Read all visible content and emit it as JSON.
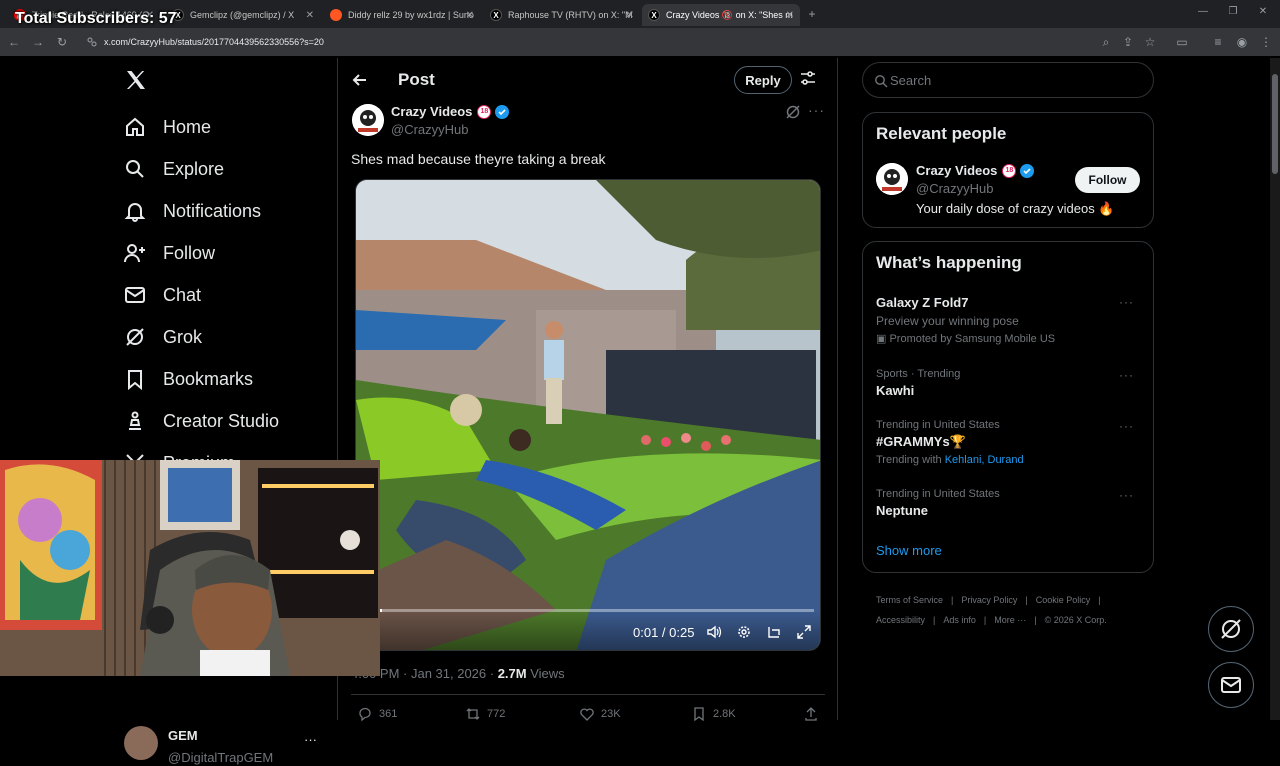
{
  "overlay": {
    "subscribers": "Total Subscribers: 57"
  },
  "browser": {
    "tabs": [
      {
        "title": "Trippie Redd - Rolex 1469 (O",
        "icon_color": "#ff0000"
      },
      {
        "title": "Gemclipz (@gemclipz) / X",
        "icon_color": "#000000"
      },
      {
        "title": "Diddy rellz 29 by wx1rdz | Suno",
        "icon_color": "#ff5722"
      },
      {
        "title": "Raphouse TV (RHTV) on X: \"M",
        "icon_color": "#000000"
      },
      {
        "title": "Crazy Videos 🔞 on X: \"Shes m",
        "icon_color": "#000000"
      }
    ],
    "url": "x.com/CrazyyHub/status/2017704439562330556?s=20"
  },
  "nav": {
    "items": [
      {
        "label": "Home",
        "icon": "home-icon"
      },
      {
        "label": "Explore",
        "icon": "search-icon"
      },
      {
        "label": "Notifications",
        "icon": "bell-icon"
      },
      {
        "label": "Follow",
        "icon": "person-plus-icon"
      },
      {
        "label": "Chat",
        "icon": "envelope-icon"
      },
      {
        "label": "Grok",
        "icon": "grok-icon"
      },
      {
        "label": "Bookmarks",
        "icon": "bookmark-icon"
      },
      {
        "label": "Creator Studio",
        "icon": "creator-icon"
      },
      {
        "label": "Premium",
        "icon": "x-icon"
      }
    ],
    "account": {
      "name": "GEM",
      "handle": "@DigitalTrapGEM"
    }
  },
  "post": {
    "header_title": "Post",
    "reply_label": "Reply",
    "author_name": "Crazy Videos",
    "author_badge": "18",
    "author_handle": "@CrazyyHub",
    "text": "Shes mad because theyre taking a break",
    "video": {
      "time": "0:01 / 0:25",
      "progress": 0.04
    },
    "meta_time": "4:00 PM · Jan 31, 2026 · ",
    "meta_views": "2.7M",
    "meta_views_label": " Views",
    "actions": {
      "replies": "361",
      "reposts": "772",
      "likes": "23K",
      "bookmarks": "2.8K"
    }
  },
  "search": {
    "placeholder": "Search"
  },
  "relevant": {
    "title": "Relevant people",
    "name": "Crazy Videos",
    "badge": "18",
    "handle": "@CrazyyHub",
    "bio": "Your daily dose of crazy videos 🔥",
    "follow_label": "Follow"
  },
  "happening": {
    "title": "What’s happening",
    "trends": [
      {
        "context": "",
        "name": "Galaxy Z Fold7",
        "sub": "Preview your winning pose",
        "promo": "Promoted by Samsung Mobile US"
      },
      {
        "context": "Sports · Trending",
        "name": "Kawhi"
      },
      {
        "context": "Trending in United States",
        "name": "#GRAMMYs🏆",
        "with_label": "Trending with ",
        "with_links": "Kehlani, Durand"
      },
      {
        "context": "Trending in United States",
        "name": "Neptune"
      }
    ],
    "show_more": "Show more"
  },
  "footer": {
    "links": [
      "Terms of Service",
      "|",
      "Privacy Policy",
      "|",
      "Cookie Policy",
      "|",
      "Accessibility",
      "|",
      "Ads info",
      "|",
      "More ···",
      "|",
      "© 2026 X Corp."
    ]
  },
  "colors": {
    "accent": "#1d9bf0",
    "background": "#000000",
    "border": "#2f3336",
    "muted": "#71767b"
  }
}
